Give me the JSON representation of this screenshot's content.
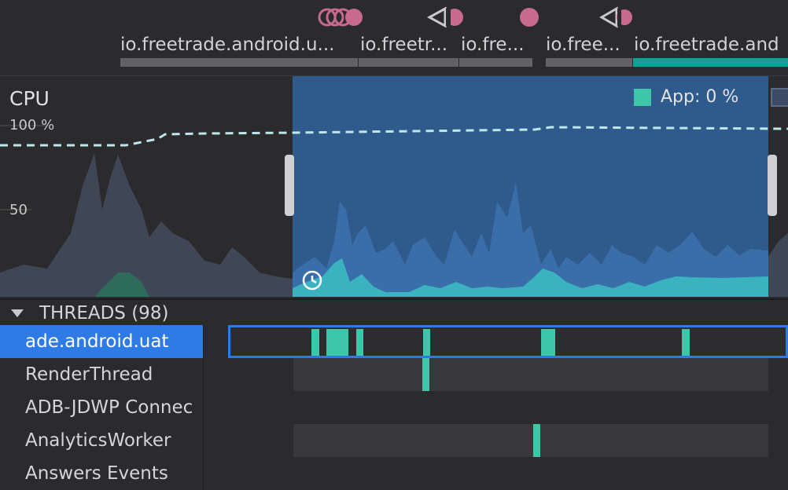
{
  "events": {
    "icons": [
      "touch-multi-icon",
      "back-button-icon",
      "touch-icon",
      "back-button-icon"
    ],
    "activities": [
      {
        "label": "io.freetrade.android.u...",
        "active": false
      },
      {
        "label": "io.freetr...",
        "active": false
      },
      {
        "label": "io.fre...",
        "active": false
      },
      {
        "label": "io.free...",
        "active": false
      },
      {
        "label": "io.freetrade.and",
        "active": true
      }
    ]
  },
  "cpu": {
    "title": "CPU",
    "ticks": [
      "100 %",
      "50"
    ],
    "legend": "App: 0 %"
  },
  "threads": {
    "header": "THREADS (98)",
    "rows": [
      {
        "name": "ade.android.uat",
        "selected": true
      },
      {
        "name": "RenderThread",
        "selected": false
      },
      {
        "name": "ADB-JDWP Connec",
        "selected": false
      },
      {
        "name": "AnalyticsWorker",
        "selected": false
      },
      {
        "name": "Answers Events",
        "selected": false
      }
    ]
  },
  "colors": {
    "accent": "#2f7be6",
    "app_cpu": "#3ec6a8",
    "selection": "#2f5a8c",
    "event": "#c86a8c"
  }
}
